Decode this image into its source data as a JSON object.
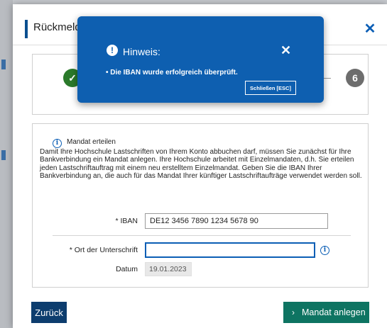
{
  "dialog": {
    "title": "Rückmeldung",
    "close_icon": "close-icon"
  },
  "stepper": {
    "done_icon": "check-icon",
    "done_symbol": "✓",
    "last_step": "6"
  },
  "mandat": {
    "heading": "Mandat erteilen",
    "info_icon": "info-icon",
    "text": "Damit Ihre Hochschule Lastschriften von Ihrem Konto abbuchen darf, müssen Sie zunächst für Ihre Bankverbindung ein Mandat anlegen. Ihre Hochschule arbeitet mit Einzelmandaten, d.h. Sie erteilen jeden Lastschriftauftrag mit einem neu erstelltem Einzelmandat. Geben Sie die IBAN Ihrer Bankverbindung an, die auch für das Mandat Ihrer künftiger Lastschriftaufträge verwendet werden soll."
  },
  "form": {
    "iban_label": "* IBAN",
    "iban_value": "DE12 3456 7890 1234 5678 90",
    "ort_label": "* Ort der Unterschrift",
    "ort_value": "",
    "datum_label": "Datum",
    "datum_value": "19.01.2023"
  },
  "footer": {
    "back_label": "Zurück",
    "mandat_label": "Mandat anlegen"
  },
  "toast": {
    "title": "Hinweis:",
    "message": "• Die IBAN wurde erfolgreich überprüft.",
    "close_button": "Schließen [ESC]"
  },
  "colors": {
    "primary": "#0e5fb0",
    "navy": "#0d3d6e",
    "teal": "#0e7462",
    "success": "#2b7a2b"
  }
}
